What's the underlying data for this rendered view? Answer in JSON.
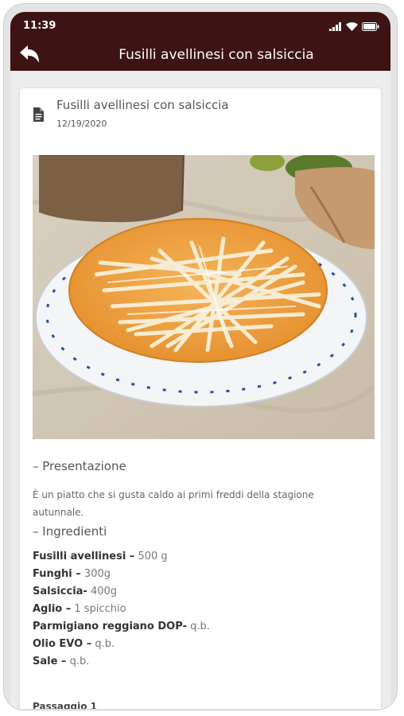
{
  "status_bar": {
    "time": "11:39"
  },
  "header": {
    "title": "Fusilli avellinesi con salsiccia"
  },
  "recipe": {
    "title": "Fusilli avellinesi con salsiccia",
    "date": "12/19/2020",
    "presentation_heading": "– Presentazione",
    "presentation_text": "È un piatto che si gusta caldo ai primi freddi della stagione autunnale.",
    "ingredients_heading": "– Ingredienti",
    "ingredients": [
      {
        "name": "Fusilli avellinesi –",
        "qty": " 500 g"
      },
      {
        "name": "Funghi –",
        "qty": " 300g"
      },
      {
        "name": "Salsiccia-",
        "qty": " 400g"
      },
      {
        "name": "Aglio –",
        "qty": " 1 spicchio"
      },
      {
        "name": "Parmigiano reggiano DOP-",
        "qty": " q.b."
      },
      {
        "name": "Olio EVO –",
        "qty": " q.b."
      },
      {
        "name": "Sale –",
        "qty": " q.b."
      }
    ],
    "step_label": "Passaggio 1"
  },
  "colors": {
    "header_bg": "#3d1313",
    "plate_orange": "#f0a446",
    "pasta": "#f4ead0"
  }
}
